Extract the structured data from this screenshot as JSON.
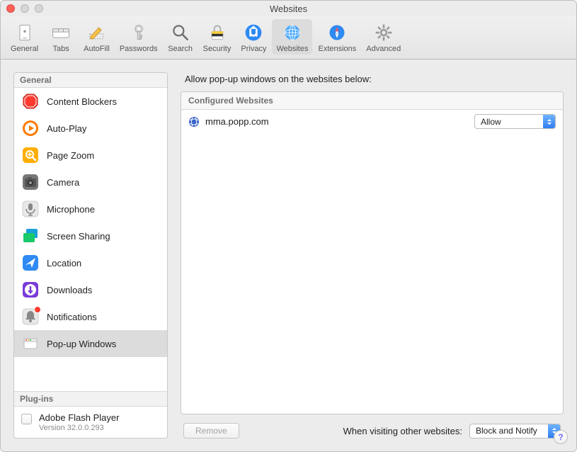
{
  "window_title": "Websites",
  "toolbar": [
    {
      "id": "general",
      "label": "General",
      "selected": false
    },
    {
      "id": "tabs",
      "label": "Tabs",
      "selected": false
    },
    {
      "id": "autofill",
      "label": "AutoFill",
      "selected": false
    },
    {
      "id": "passwords",
      "label": "Passwords",
      "selected": false
    },
    {
      "id": "search",
      "label": "Search",
      "selected": false
    },
    {
      "id": "security",
      "label": "Security",
      "selected": false
    },
    {
      "id": "privacy",
      "label": "Privacy",
      "selected": false
    },
    {
      "id": "websites",
      "label": "Websites",
      "selected": true
    },
    {
      "id": "extensions",
      "label": "Extensions",
      "selected": false
    },
    {
      "id": "advanced",
      "label": "Advanced",
      "selected": false
    }
  ],
  "sidebar": {
    "groups": [
      {
        "title": "General",
        "items": [
          {
            "id": "content-blockers",
            "icon": "content-blockers-icon",
            "label": "Content Blockers"
          },
          {
            "id": "auto-play",
            "icon": "auto-play-icon",
            "label": "Auto-Play"
          },
          {
            "id": "page-zoom",
            "icon": "page-zoom-icon",
            "label": "Page Zoom"
          },
          {
            "id": "camera",
            "icon": "camera-icon",
            "label": "Camera"
          },
          {
            "id": "microphone",
            "icon": "microphone-icon",
            "label": "Microphone"
          },
          {
            "id": "screen-sharing",
            "icon": "screen-sharing-icon",
            "label": "Screen Sharing"
          },
          {
            "id": "location",
            "icon": "location-icon",
            "label": "Location"
          },
          {
            "id": "downloads",
            "icon": "downloads-icon",
            "label": "Downloads"
          },
          {
            "id": "notifications",
            "icon": "notifications-icon",
            "label": "Notifications",
            "badge": true
          },
          {
            "id": "popup-windows",
            "icon": "popup-windows-icon",
            "label": "Pop-up Windows",
            "selected": true
          }
        ]
      },
      {
        "title": "Plug-ins",
        "plugins": [
          {
            "name": "Adobe Flash Player",
            "version": "Version 32.0.0.293",
            "enabled": false
          }
        ]
      }
    ]
  },
  "pane": {
    "title": "Allow pop-up windows on the websites below:",
    "configured_title": "Configured Websites",
    "sites": [
      {
        "favicon": "globe-icon",
        "host": "mma.popp.com",
        "setting": "Allow"
      }
    ],
    "remove_label": "Remove",
    "other_label": "When visiting other websites:",
    "other_value": "Block and Notify"
  },
  "help_label": "?"
}
